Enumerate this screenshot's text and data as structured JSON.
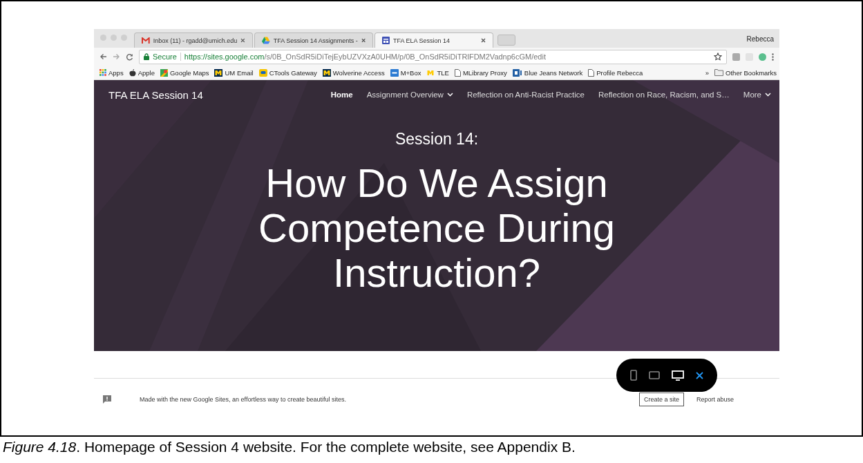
{
  "browser": {
    "tabs": [
      {
        "title": "Inbox (11) - rgadd@umich.edu",
        "selected": false
      },
      {
        "title": "TFA Session 14 Assignments -",
        "selected": false
      },
      {
        "title": "TFA ELA Session 14",
        "selected": true
      }
    ],
    "profile": "Rebecca",
    "secure_label": "Secure",
    "url_host": "https://sites.google.com",
    "url_path": "/s/0B_OnSdR5iDiTejEybUZVXzA0UHM/p/0B_OnSdR5iDiTRlFDM2Vadnp6cGM/edit",
    "bookmarks": [
      {
        "label": "Apps"
      },
      {
        "label": "Apple"
      },
      {
        "label": "Google Maps"
      },
      {
        "label": "UM Email"
      },
      {
        "label": "CTools Gateway"
      },
      {
        "label": "Wolverine Access"
      },
      {
        "label": "M+Box"
      },
      {
        "label": "TLE"
      },
      {
        "label": "MLibrary Proxy"
      },
      {
        "label": "Blue Jeans Network"
      },
      {
        "label": "Profile Rebecca"
      }
    ],
    "overflow": "»",
    "other_bookmarks": "Other Bookmarks"
  },
  "site": {
    "title": "TFA ELA Session 14",
    "nav": [
      {
        "label": "Home",
        "selected": true,
        "menu": false
      },
      {
        "label": "Assignment Overview",
        "selected": false,
        "menu": true
      },
      {
        "label": "Reflection on Anti-Racist Practice",
        "selected": false,
        "menu": false
      },
      {
        "label": "Reflection on Race, Racism, and S…",
        "selected": false,
        "menu": false
      },
      {
        "label": "More",
        "selected": false,
        "menu": true
      }
    ],
    "subtitle": "Session 14:",
    "heading_lines": [
      "How Do We Assign",
      "Competence During",
      "Instruction?"
    ],
    "footer_text": "Made with the new Google Sites, an effortless way to create beautiful sites.",
    "footer_links": [
      "Create a site",
      "Report abuse"
    ],
    "preview_devices": [
      {
        "selected": false
      },
      {
        "selected": false
      },
      {
        "selected": true
      }
    ]
  },
  "caption": "*Figure 4.18*. Homepage of Session 4 website. For the complete website, see Appendix B."
}
